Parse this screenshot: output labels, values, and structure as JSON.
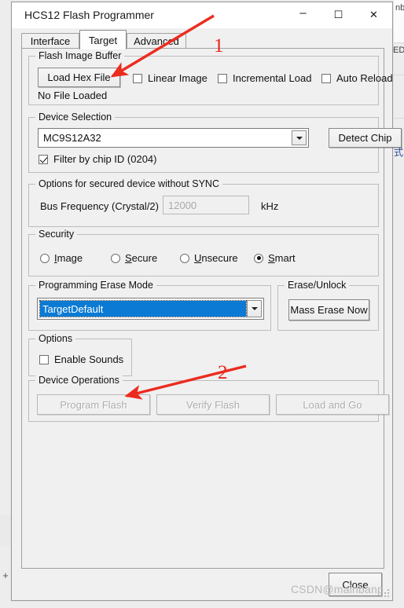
{
  "window": {
    "title": "HCS12 Flash Programmer",
    "buttons": {
      "minimize": "–",
      "maximize": "☐",
      "close": "✕"
    }
  },
  "tabs": [
    {
      "label": "Interface",
      "active": false
    },
    {
      "label": "Target",
      "active": true
    },
    {
      "label": "Advanced",
      "active": false
    }
  ],
  "flash_image_buffer": {
    "legend": "Flash Image Buffer",
    "load_button": "Load Hex File",
    "checkboxes": [
      {
        "label": "Linear Image",
        "checked": false
      },
      {
        "label": "Incremental Load",
        "checked": false
      },
      {
        "label": "Auto Reload",
        "checked": false
      }
    ],
    "status": "No File Loaded"
  },
  "device_selection": {
    "legend": "Device Selection",
    "device": "MC9S12A32",
    "detect_button": "Detect Chip",
    "filter_checkbox": {
      "label": "Filter by chip ID (0204)",
      "checked": true
    }
  },
  "secured_options": {
    "legend": "Options for secured device without SYNC",
    "bus_frequency_label": "Bus Frequency (Crystal/2)",
    "bus_frequency_value": "12000",
    "bus_frequency_unit": "kHz",
    "disabled": true
  },
  "security": {
    "legend": "Security",
    "options": [
      {
        "label": "Image",
        "accel": "I",
        "rest": "mage",
        "selected": false
      },
      {
        "label": "Secure",
        "accel": "S",
        "rest": "ecure",
        "selected": false
      },
      {
        "label": "Unsecure",
        "accel": "U",
        "rest": "nsecure",
        "selected": false
      },
      {
        "label": "Smart",
        "accel": "S",
        "rest": "mart",
        "selected": true
      }
    ]
  },
  "erase_mode": {
    "legend": "Programming Erase Mode",
    "value": "TargetDefault",
    "focused": true
  },
  "erase_unlock": {
    "legend": "Erase/Unlock",
    "button": "Mass Erase Now"
  },
  "options": {
    "legend": "Options",
    "enable_sounds": {
      "label": "Enable Sounds",
      "checked": false
    }
  },
  "device_operations": {
    "legend": "Device Operations",
    "buttons": [
      {
        "label": "Program Flash",
        "disabled": true
      },
      {
        "label": "Verify Flash",
        "disabled": true
      },
      {
        "label": "Load and Go",
        "disabled": true
      }
    ]
  },
  "footer": {
    "close_button": "Close"
  },
  "annotations": {
    "color": "#ec2b1f",
    "markers": [
      {
        "number": "1"
      },
      {
        "number": "2"
      }
    ]
  },
  "watermark": {
    "text": "CSDN@mainbanp"
  },
  "background": {
    "fragment_1": "ED",
    "fragment_2": "式",
    "fragment_3": "nb"
  }
}
